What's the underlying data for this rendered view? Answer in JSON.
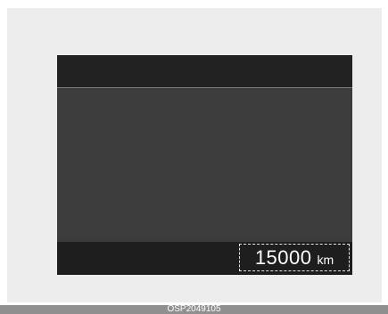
{
  "display": {
    "odometer": {
      "value": "15000",
      "unit": "km"
    }
  },
  "caption": "OSP2049105"
}
